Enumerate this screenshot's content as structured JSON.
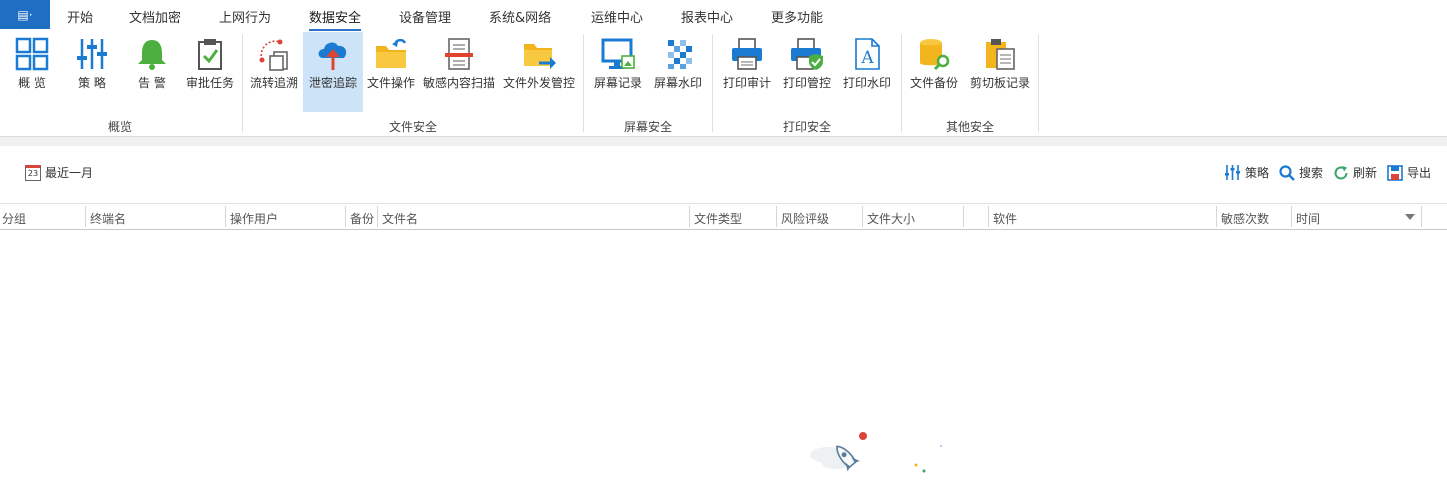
{
  "menu": {
    "app_button": "▤·",
    "tabs": [
      "开始",
      "文档加密",
      "上网行为",
      "数据安全",
      "设备管理",
      "系统&网络",
      "运维中心",
      "报表中心",
      "更多功能"
    ],
    "active": "数据安全"
  },
  "ribbon": {
    "groups": [
      {
        "label": "概览",
        "items": [
          "概 览",
          "策 略",
          "告 警",
          "审批任务"
        ]
      },
      {
        "label": "文件安全",
        "items": [
          "流转追溯",
          "泄密追踪",
          "文件操作",
          "敏感内容扫描",
          "文件外发管控"
        ]
      },
      {
        "label": "屏幕安全",
        "items": [
          "屏幕记录",
          "屏幕水印"
        ]
      },
      {
        "label": "打印安全",
        "items": [
          "打印审计",
          "打印管控",
          "打印水印"
        ]
      },
      {
        "label": "其他安全",
        "items": [
          "文件备份",
          "剪切板记录"
        ]
      }
    ],
    "selected_item": "泄密追踪"
  },
  "toolbar": {
    "date_filter": "最近一月",
    "calendar_day": "23",
    "actions": [
      "策略",
      "搜索",
      "刷新",
      "导出"
    ]
  },
  "table": {
    "columns": [
      "分组",
      "终端名",
      "操作用户",
      "备份",
      "文件名",
      "文件类型",
      "风险评级",
      "文件大小",
      "软件",
      "敏感次数",
      "时间"
    ],
    "rows": []
  },
  "colors": {
    "accent": "#1e6fc3",
    "selected_bg": "#cde3f7",
    "icon_blue": "#1b7ad1",
    "icon_green": "#4caf3f",
    "icon_yellow": "#f3b51e"
  }
}
